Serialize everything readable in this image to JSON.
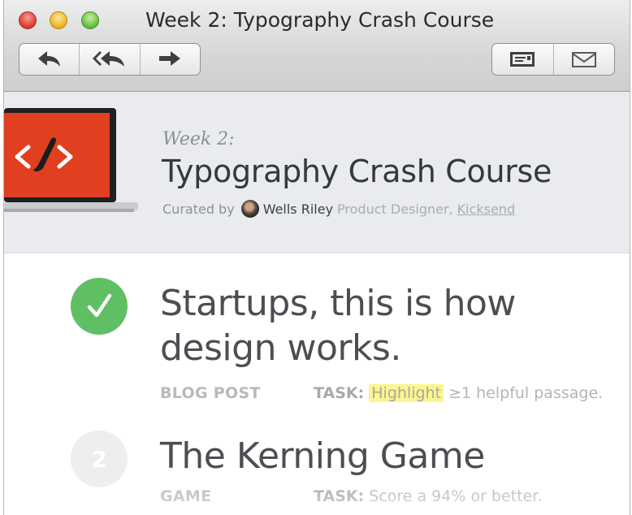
{
  "window": {
    "title": "Week 2: Typography Crash Course"
  },
  "toolbar": {
    "back_icon": "reply-arrow-icon",
    "back_all_icon": "reply-all-arrow-icon",
    "forward_icon": "forward-arrow-icon",
    "card_icon": "id-card-icon",
    "mail_icon": "envelope-icon"
  },
  "header": {
    "week_label": "Week 2:",
    "title": "Typography Crash Course",
    "curated_by": "Curated by",
    "author_name": "Wells Riley",
    "author_role": "Product Designer,",
    "author_company": "Kicksend",
    "logo_glyph": "</>"
  },
  "items": [
    {
      "status": "completed",
      "title": "Startups, this is how design works.",
      "type": "BLOG POST",
      "task_label": "TASK:",
      "task_highlight": "Highlight",
      "task_rest": "≥1 helpful passage."
    },
    {
      "number": "2",
      "title": "The Kerning Game",
      "type": "GAME",
      "task_label": "TASK:",
      "task_text": "Score a 94% or better."
    }
  ],
  "colors": {
    "done_badge": "#5fbf64",
    "logo_red": "#e0401f",
    "highlight": "#fbf58f"
  }
}
